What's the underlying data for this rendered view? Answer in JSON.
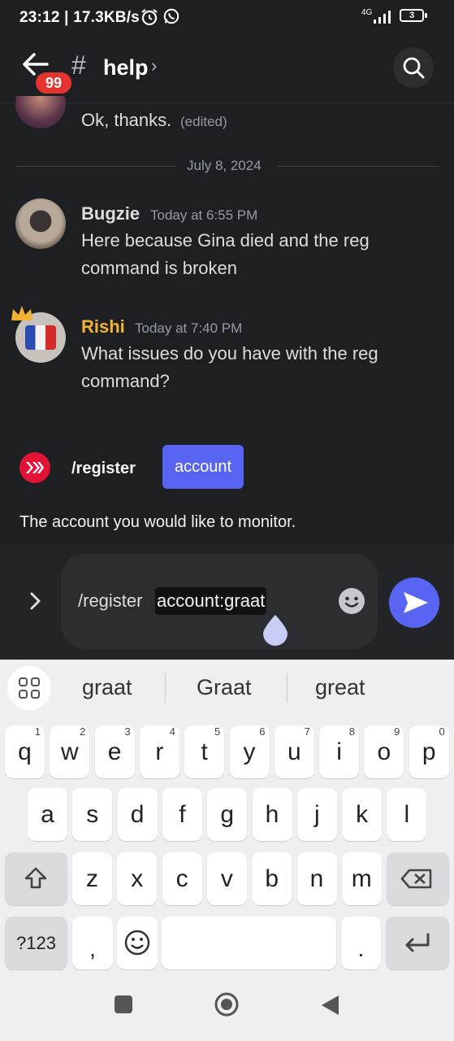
{
  "status_bar": {
    "time": "23:12 | 17.3KB/s",
    "network": "4G",
    "battery": "3"
  },
  "header": {
    "unread_badge": "99",
    "channel_hash": "#",
    "channel_name": "help",
    "chevron": "›"
  },
  "messages": {
    "prev_text": "Ok, thanks.",
    "prev_edited": "(edited)",
    "date_divider": "July 8, 2024",
    "bugzie": {
      "name": "Bugzie",
      "time": "Today at 6:55 PM",
      "line1": "Here because Gina died and the reg",
      "line2": "command is broken",
      "name_color": "#f2f3f5"
    },
    "rishi": {
      "name": "Rishi",
      "time": "Today at 7:40 PM",
      "line1": "What issues do you have with the reg",
      "line2": "command?",
      "name_color": "#f0b232"
    }
  },
  "command": {
    "name": "/register",
    "option": "account",
    "description": "The account you would like to monitor."
  },
  "composer": {
    "prefix": "/register",
    "option_text": "account:graat"
  },
  "keyboard": {
    "suggestions": [
      "graat",
      "Graat",
      "great"
    ],
    "row1": [
      [
        "q",
        "1"
      ],
      [
        "w",
        "2"
      ],
      [
        "e",
        "3"
      ],
      [
        "r",
        "4"
      ],
      [
        "t",
        "5"
      ],
      [
        "y",
        "6"
      ],
      [
        "u",
        "7"
      ],
      [
        "i",
        "8"
      ],
      [
        "o",
        "9"
      ],
      [
        "p",
        "0"
      ]
    ],
    "row2": [
      "a",
      "s",
      "d",
      "f",
      "g",
      "h",
      "j",
      "k",
      "l"
    ],
    "row3": [
      "z",
      "x",
      "c",
      "v",
      "b",
      "n",
      "m"
    ],
    "sym_label": "?123",
    "comma": ",",
    "period": "."
  }
}
